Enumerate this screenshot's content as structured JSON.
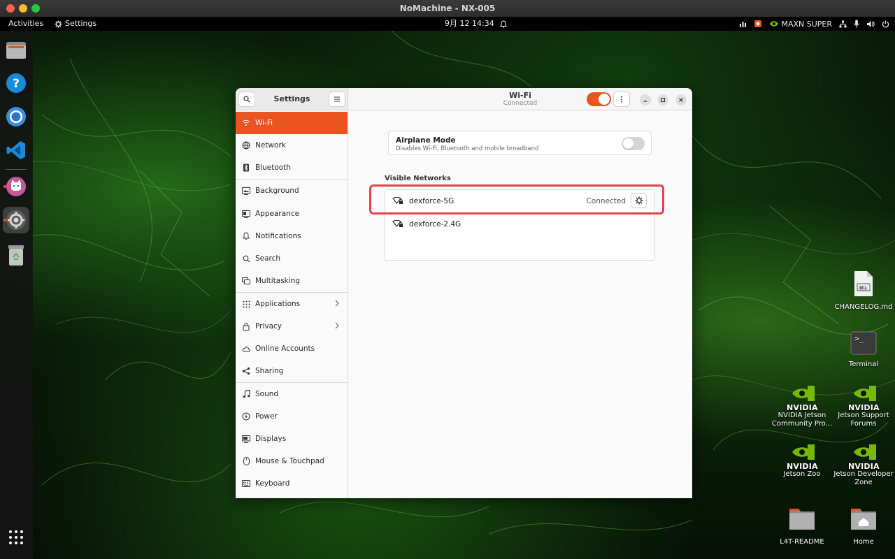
{
  "window_title": "NoMachine - NX-005",
  "topbar": {
    "activities": "Activities",
    "app_menu": "Settings",
    "clock": "9月 12  14:34",
    "power_mode": "MAXN SUPER"
  },
  "desktop_icons": {
    "changelog": "CHANGELOG.md",
    "terminal": "Terminal",
    "nvidia_community": "NVIDIA Jetson Community Pro...",
    "jetson_support": "Jetson Support Forums",
    "jetson_zoo": "Jetson Zoo",
    "jetson_dev_zone": "Jetson Developer Zone",
    "l4t_readme": "L4T-README",
    "home": "Home",
    "nvidia_word": "NVIDIA"
  },
  "settings": {
    "title": "Settings",
    "panel_title": "Wi-Fi",
    "panel_subtitle": "Connected",
    "wifi_enabled": true,
    "sidebar": [
      {
        "label": "Wi-Fi",
        "icon": "wifi-icon",
        "active": true
      },
      {
        "label": "Network",
        "icon": "network-icon"
      },
      {
        "label": "Bluetooth",
        "icon": "bluetooth-icon"
      },
      {
        "label": "Background",
        "icon": "background-icon"
      },
      {
        "label": "Appearance",
        "icon": "appearance-icon"
      },
      {
        "label": "Notifications",
        "icon": "bell-icon"
      },
      {
        "label": "Search",
        "icon": "search-icon"
      },
      {
        "label": "Multitasking",
        "icon": "multitasking-icon"
      },
      {
        "label": "Applications",
        "icon": "apps-icon",
        "chevron": true
      },
      {
        "label": "Privacy",
        "icon": "lock-icon",
        "chevron": true
      },
      {
        "label": "Online Accounts",
        "icon": "cloud-icon"
      },
      {
        "label": "Sharing",
        "icon": "share-icon"
      },
      {
        "label": "Sound",
        "icon": "music-icon"
      },
      {
        "label": "Power",
        "icon": "power-icon"
      },
      {
        "label": "Displays",
        "icon": "display-icon"
      },
      {
        "label": "Mouse & Touchpad",
        "icon": "mouse-icon"
      },
      {
        "label": "Keyboard",
        "icon": "keyboard-icon"
      }
    ],
    "airplane": {
      "title": "Airplane Mode",
      "subtitle": "Disables Wi-Fi, Bluetooth and mobile broadband",
      "enabled": false
    },
    "visible_networks_label": "Visible Networks",
    "networks": [
      {
        "ssid": "dexforce-5G",
        "status": "Connected"
      },
      {
        "ssid": "dexforce-2.4G",
        "status": ""
      }
    ]
  },
  "colors": {
    "accent": "#e95420",
    "highlight_box": "#e0454a",
    "nvidia_green": "#76b900"
  }
}
